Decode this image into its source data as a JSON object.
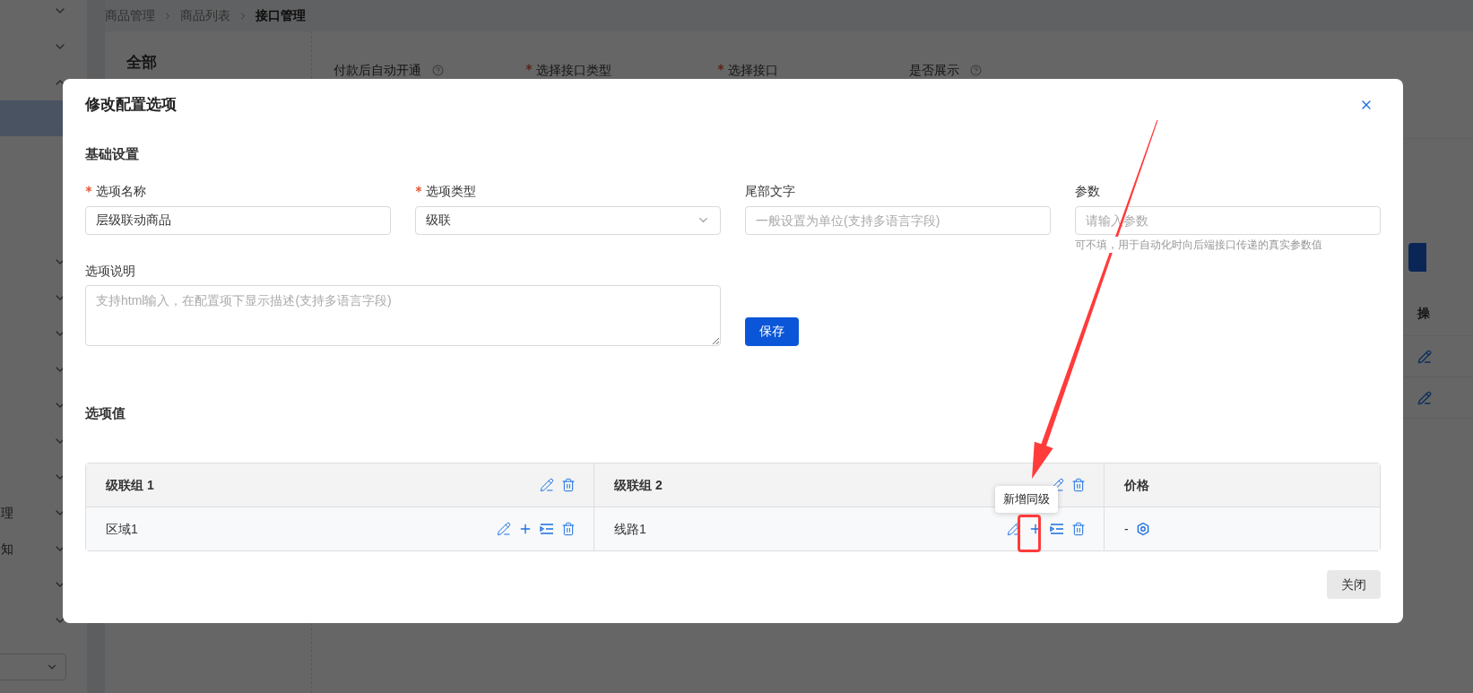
{
  "background": {
    "sidebar": [
      {
        "kind": "group",
        "expanded": false
      },
      {
        "kind": "group",
        "expanded": false
      },
      {
        "kind": "group",
        "expanded": true
      },
      {
        "kind": "child",
        "selected": true
      },
      {
        "kind": "child",
        "selected": false
      },
      {
        "kind": "child",
        "selected": false
      },
      {
        "kind": "child",
        "selected": false
      },
      {
        "kind": "group",
        "expanded": false
      },
      {
        "kind": "group",
        "expanded": false
      },
      {
        "kind": "group",
        "expanded": false
      },
      {
        "kind": "group",
        "expanded": false
      },
      {
        "kind": "group",
        "expanded": false
      },
      {
        "kind": "group",
        "expanded": false
      },
      {
        "kind": "group",
        "expanded": false
      },
      {
        "kind": "group",
        "label": "理",
        "expanded": false
      },
      {
        "kind": "group",
        "label": "知",
        "expanded": false
      },
      {
        "kind": "group",
        "expanded": false
      },
      {
        "kind": "group",
        "expanded": false
      }
    ],
    "breadcrumb": [
      "商品管理",
      "商品列表",
      "接口管理"
    ],
    "category": "全部",
    "form_labels": [
      {
        "text": "付款后自动开通",
        "required": false,
        "help": true
      },
      {
        "text": "选择接口类型",
        "required": true,
        "help": false
      },
      {
        "text": "选择接口",
        "required": true,
        "help": false
      },
      {
        "text": "是否展示",
        "required": false,
        "help": true
      }
    ],
    "table_header": "操"
  },
  "dialog": {
    "title": "修改配置选项",
    "basic_title": "基础设置",
    "fields": [
      {
        "label": "选项名称",
        "required": true,
        "kind": "input",
        "value": "层级联动商品"
      },
      {
        "label": "选项类型",
        "required": true,
        "kind": "select",
        "value": "级联"
      },
      {
        "label": "尾部文字",
        "required": false,
        "kind": "input",
        "placeholder": "一般设置为单位(支持多语言字段)"
      },
      {
        "label": "参数",
        "required": false,
        "kind": "input",
        "placeholder": "请输入参数",
        "hint": "可不填，用于自动化时向后端接口传递的真实参数值"
      }
    ],
    "description": {
      "label": "选项说明",
      "placeholder": "支持html输入，在配置项下显示描述(支持多语言字段)"
    },
    "save_button": "保存",
    "values_title": "选项值",
    "table": {
      "columns": [
        {
          "label": "级联组 1",
          "actions": [
            {
              "kind": "edit"
            },
            {
              "kind": "delete"
            }
          ]
        },
        {
          "label": "级联组 2",
          "actions": [
            {
              "kind": "edit"
            },
            {
              "kind": "delete"
            }
          ]
        },
        {
          "label": "价格"
        }
      ],
      "rows": [
        {
          "cells": [
            {
              "text": "区域1",
              "actions": [
                {
                  "kind": "edit"
                },
                {
                  "kind": "add"
                },
                {
                  "kind": "indent"
                },
                {
                  "kind": "delete"
                }
              ]
            },
            {
              "text": "线路1",
              "actions": [
                {
                  "kind": "edit"
                },
                {
                  "kind": "add"
                },
                {
                  "kind": "indent"
                },
                {
                  "kind": "delete"
                }
              ]
            },
            {
              "text": "-",
              "actions": [
                {
                  "kind": "settings"
                }
              ]
            }
          ]
        }
      ]
    },
    "tooltip": "新增同级",
    "close_button": "关闭"
  }
}
